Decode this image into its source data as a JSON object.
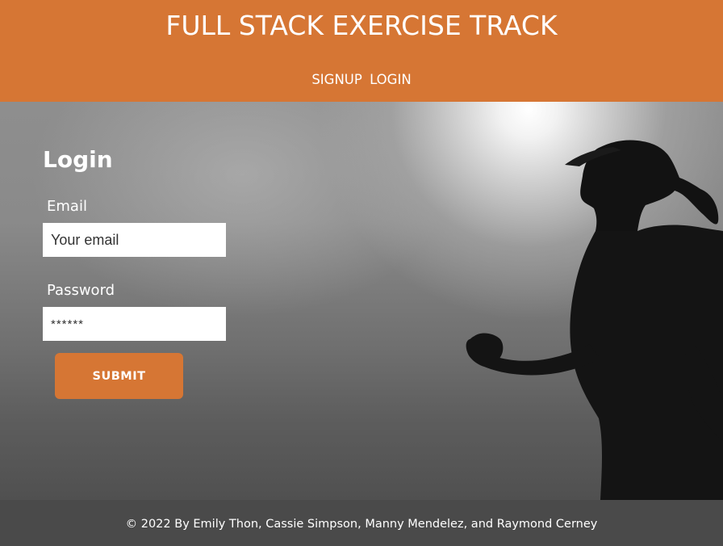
{
  "header": {
    "title": "FULL STACK EXERCISE TRACK",
    "nav": {
      "signup": "SIGNUP",
      "login": "LOGIN"
    }
  },
  "login_form": {
    "heading": "Login",
    "email_label": "Email",
    "email_placeholder": "Your email",
    "password_label": "Password",
    "password_placeholder": "******",
    "submit_label": "SUBMIT"
  },
  "footer": {
    "text": "© 2022 By Emily Thon, Cassie Simpson, Manny Mendelez, and Raymond Cerney"
  },
  "colors": {
    "accent": "#d67634",
    "footer_bg": "#4a4a4a"
  }
}
